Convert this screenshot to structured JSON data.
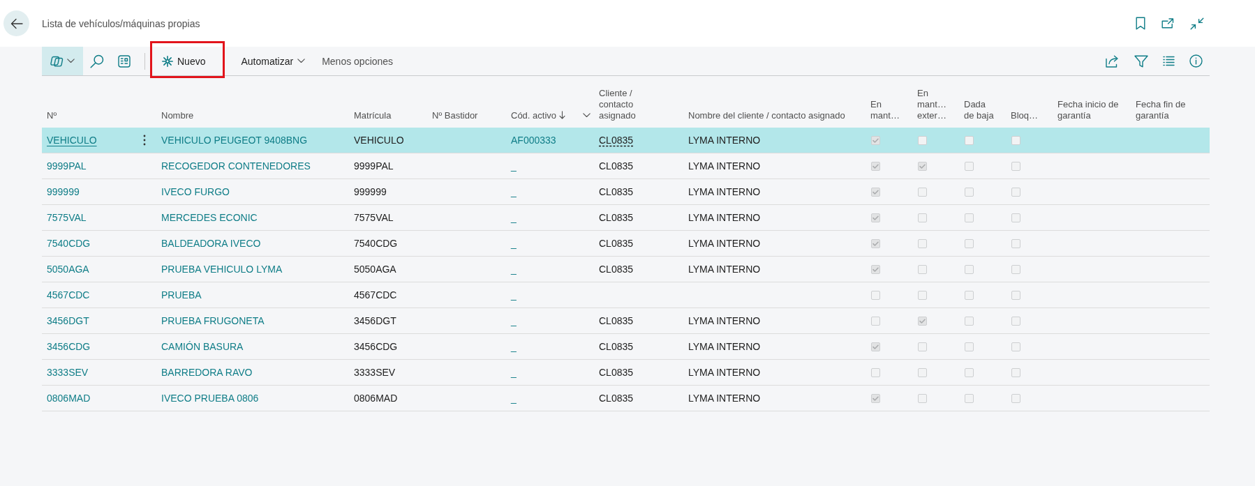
{
  "page": {
    "title": "Lista de vehículos/máquinas propias"
  },
  "toolbar": {
    "tools": [
      {
        "kind": "views",
        "selected": true
      },
      {
        "kind": "search",
        "selected": false
      },
      {
        "kind": "layout",
        "selected": false
      }
    ],
    "actions": [
      {
        "kind": "new",
        "label": "Nuevo",
        "highlighted": true
      },
      {
        "kind": "menu",
        "label": "Automatizar",
        "highlighted": false
      },
      {
        "kind": "plain",
        "label": "Menos opciones",
        "highlighted": false
      }
    ]
  },
  "table": {
    "columns": [
      {
        "label": "Nº",
        "sorted": false
      },
      {
        "label": "Nombre",
        "sorted": false
      },
      {
        "label": "Matrícula",
        "sorted": false
      },
      {
        "label": "Nº Bastidor",
        "sorted": false
      },
      {
        "label": "Cód. activo",
        "sorted": true
      },
      {
        "label": "Cliente / contacto asignado",
        "sorted": false
      },
      {
        "label": "Nombre del cliente / contacto asignado",
        "sorted": false
      },
      {
        "label": "En mant…",
        "sorted": false
      },
      {
        "label": "En mant… exter…",
        "sorted": false
      },
      {
        "label": "Dada de baja",
        "sorted": false
      },
      {
        "label": "Bloq…",
        "sorted": false
      },
      {
        "label": "Fecha inicio de garantía",
        "sorted": false
      },
      {
        "label": "Fecha fin de garantía",
        "sorted": false
      }
    ],
    "rows": [
      {
        "selected": true,
        "no": "VEHICULO",
        "nombre": "VEHICULO PEUGEOT 9408BNG",
        "matricula": "VEHICULO",
        "cod_activo": "AF000333",
        "cliente": "CL0835",
        "nombre_cliente": "LYMA INTERNO",
        "en_mant": true,
        "en_mant_exter": false,
        "dada_de_baja": false,
        "bloq": false
      },
      {
        "selected": false,
        "no": "9999PAL",
        "nombre": "RECOGEDOR CONTENEDORES",
        "matricula": "9999PAL",
        "cod_activo": "_",
        "cliente": "CL0835",
        "nombre_cliente": "LYMA INTERNO",
        "en_mant": true,
        "en_mant_exter": true,
        "dada_de_baja": false,
        "bloq": false
      },
      {
        "selected": false,
        "no": "999999",
        "nombre": "IVECO FURGO",
        "matricula": "999999",
        "cod_activo": "_",
        "cliente": "CL0835",
        "nombre_cliente": "LYMA INTERNO",
        "en_mant": true,
        "en_mant_exter": false,
        "dada_de_baja": false,
        "bloq": false
      },
      {
        "selected": false,
        "no": "7575VAL",
        "nombre": "MERCEDES ECONIC",
        "matricula": "7575VAL",
        "cod_activo": "_",
        "cliente": "CL0835",
        "nombre_cliente": "LYMA INTERNO",
        "en_mant": true,
        "en_mant_exter": false,
        "dada_de_baja": false,
        "bloq": false
      },
      {
        "selected": false,
        "no": "7540CDG",
        "nombre": "BALDEADORA IVECO",
        "matricula": "7540CDG",
        "cod_activo": "_",
        "cliente": "CL0835",
        "nombre_cliente": "LYMA INTERNO",
        "en_mant": true,
        "en_mant_exter": false,
        "dada_de_baja": false,
        "bloq": false
      },
      {
        "selected": false,
        "no": "5050AGA",
        "nombre": "PRUEBA VEHICULO LYMA",
        "matricula": "5050AGA",
        "cod_activo": "_",
        "cliente": "CL0835",
        "nombre_cliente": "LYMA INTERNO",
        "en_mant": true,
        "en_mant_exter": false,
        "dada_de_baja": false,
        "bloq": false
      },
      {
        "selected": false,
        "no": "4567CDC",
        "nombre": "PRUEBA",
        "matricula": "4567CDC",
        "cod_activo": "_",
        "en_mant": false,
        "en_mant_exter": false,
        "dada_de_baja": false,
        "bloq": false
      },
      {
        "selected": false,
        "no": "3456DGT",
        "nombre": "PRUEBA FRUGONETA",
        "matricula": "3456DGT",
        "cod_activo": "_",
        "cliente": "CL0835",
        "nombre_cliente": "LYMA INTERNO",
        "en_mant": false,
        "en_mant_exter": true,
        "dada_de_baja": false,
        "bloq": false
      },
      {
        "selected": false,
        "no": "3456CDG",
        "nombre": "CAMIÓN BASURA",
        "matricula": "3456CDG",
        "cod_activo": "_",
        "cliente": "CL0835",
        "nombre_cliente": "LYMA INTERNO",
        "en_mant": true,
        "en_mant_exter": false,
        "dada_de_baja": false,
        "bloq": false
      },
      {
        "selected": false,
        "no": "3333SEV",
        "nombre": "BARREDORA RAVO",
        "matricula": "3333SEV",
        "cod_activo": "_",
        "cliente": "CL0835",
        "nombre_cliente": "LYMA INTERNO",
        "en_mant": false,
        "en_mant_exter": false,
        "dada_de_baja": false,
        "bloq": false
      },
      {
        "selected": false,
        "no": "0806MAD",
        "nombre": "IVECO PRUEBA 0806",
        "matricula": "0806MAD",
        "cod_activo": "_",
        "cliente": "CL0835",
        "nombre_cliente": "LYMA INTERNO",
        "en_mant": true,
        "en_mant_exter": false,
        "dada_de_baja": false,
        "bloq": false
      }
    ]
  }
}
